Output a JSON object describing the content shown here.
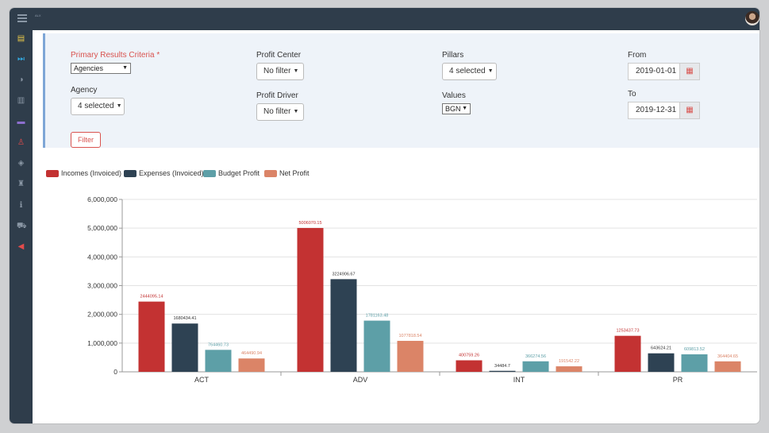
{
  "app": {
    "logo_text": "ALX"
  },
  "sidebar": {
    "icons": [
      {
        "name": "document-icon",
        "glyph": "▤",
        "color": "#e8c84a"
      },
      {
        "name": "fast-forward-icon",
        "glyph": "⏭",
        "color": "#33a9e0"
      },
      {
        "name": "half-circle-icon",
        "glyph": "◑",
        "color": "#8a97a5"
      },
      {
        "name": "book-icon",
        "glyph": "▥",
        "color": "#8a97a5"
      },
      {
        "name": "folder-icon",
        "glyph": "▬",
        "color": "#8e6fcf"
      },
      {
        "name": "user-icon",
        "glyph": "♙",
        "color": "#e24b4b"
      },
      {
        "name": "cube-icon",
        "glyph": "◈",
        "color": "#8a97a5"
      },
      {
        "name": "trophy-icon",
        "glyph": "♜",
        "color": "#8a97a5"
      },
      {
        "name": "info-icon",
        "glyph": "ℹ",
        "color": "#8a97a5"
      },
      {
        "name": "cart-icon",
        "glyph": "⛟",
        "color": "#8a97a5"
      },
      {
        "name": "megaphone-icon",
        "glyph": "◀",
        "color": "#e24b4b"
      }
    ]
  },
  "filters": {
    "primary_label": "Primary Results Criteria *",
    "primary_value": "Agencies",
    "agency_label": "Agency",
    "agency_value": "4 selected",
    "profit_center_label": "Profit Center",
    "profit_center_value": "No filter",
    "profit_driver_label": "Profit Driver",
    "profit_driver_value": "No filter",
    "pillars_label": "Pillars",
    "pillars_value": "4 selected",
    "values_label": "Values",
    "values_value": "BGN",
    "from_label": "From",
    "from_value": "2019-01-01",
    "to_label": "To",
    "to_value": "2019-12-31",
    "filter_button": "Filter"
  },
  "chart_data": {
    "type": "bar",
    "categories": [
      "ACT",
      "ADV",
      "INT",
      "PR"
    ],
    "series": [
      {
        "name": "Incomes (Invoiced)",
        "color": "#c33232",
        "values": [
          2444095.14,
          5006070.15,
          400759.26,
          1253437.73
        ],
        "labels": [
          "2444095.14",
          "5006070.15",
          "400759.26",
          "1253437.73"
        ]
      },
      {
        "name": "Expenses (Invoiced)",
        "color": "#2e4253",
        "values": [
          1680434.41,
          3224906.67,
          34484.7,
          643624.21
        ],
        "labels": [
          "1680434.41",
          "3224906.67",
          "34484.7",
          "643624.21"
        ]
      },
      {
        "name": "Budget Profit",
        "color": "#5d9fa7",
        "values": [
          764460.73,
          1781163.48,
          366274.56,
          609813.52
        ],
        "labels": [
          "764460.73",
          "1781163.48",
          "366274.56",
          "609813.52"
        ]
      },
      {
        "name": "Net Profit",
        "color": "#db8467",
        "values": [
          464490.94,
          1077818.54,
          191542.22,
          364404.65
        ],
        "labels": [
          "464490.94",
          "1077818.54",
          "191542.22",
          "364404.65"
        ]
      }
    ],
    "yticks": [
      "0",
      "1,000,000",
      "2,000,000",
      "3,000,000",
      "4,000,000",
      "5,000,000",
      "6,000,000"
    ],
    "ylim": [
      0,
      6000000
    ],
    "grid": true,
    "legend": "top-left"
  }
}
